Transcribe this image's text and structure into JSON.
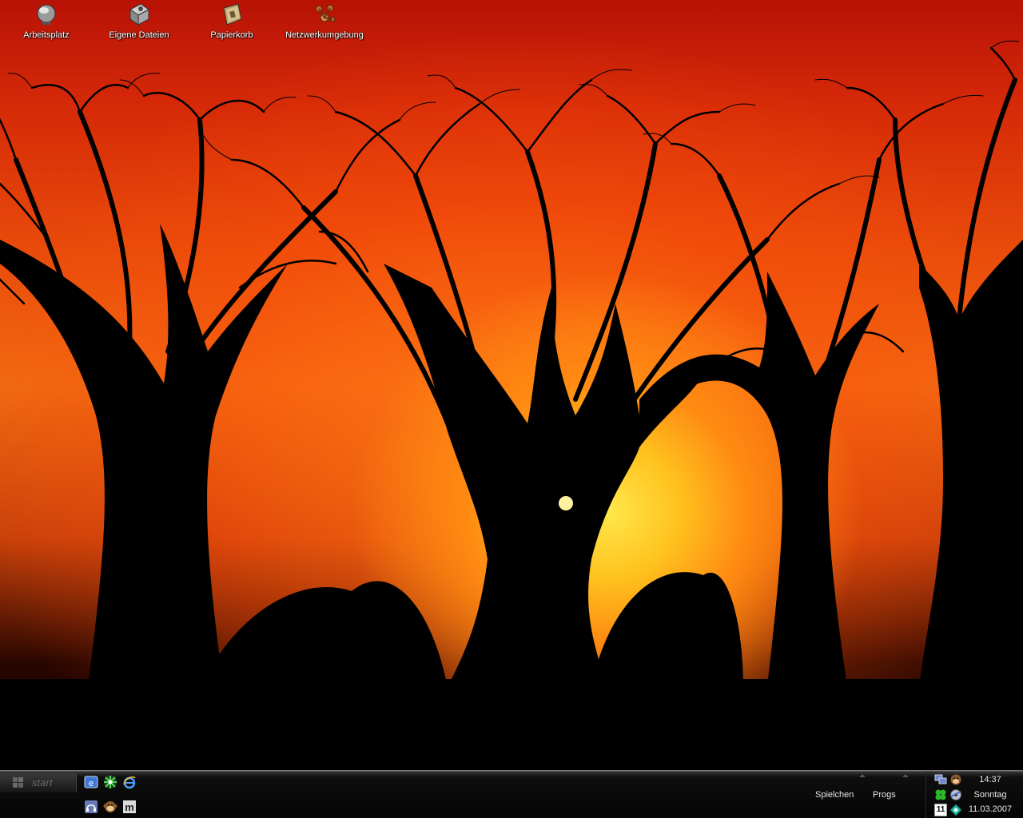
{
  "desktop": {
    "icons": [
      {
        "label": "Arbeitsplatz",
        "icon": "my-computer-icon"
      },
      {
        "label": "Eigene Dateien",
        "icon": "my-documents-icon"
      },
      {
        "label": "Papierkorb",
        "icon": "recycle-bin-icon"
      },
      {
        "label": "Netzwerkumgebung",
        "icon": "network-places-icon"
      }
    ]
  },
  "taskbar": {
    "start_label": "start",
    "quick_launch": [
      {
        "icon": "email-client-icon"
      },
      {
        "icon": "green-star-app-icon"
      },
      {
        "icon": "internet-explorer-icon"
      },
      {
        "icon": "headphones-app-icon"
      },
      {
        "icon": "monkey-app-icon"
      },
      {
        "icon": "m-app-icon"
      }
    ],
    "toolbars": {
      "games_label": "Spielchen",
      "programs_label": "Progs"
    },
    "tray": {
      "icons": [
        "network-monitor-icon",
        "messenger-icon",
        "clover-icon",
        "disk-icon",
        "calendar-icon",
        "globe-icon"
      ],
      "calendar_day": "11",
      "time": "14:37",
      "weekday": "Sonntag",
      "date": "11.03.2007"
    }
  },
  "colors": {
    "sky_top": "#b81206",
    "sky_mid": "#f06a12",
    "sun": "#ffe84a",
    "taskbar": "#0e0e0e"
  }
}
